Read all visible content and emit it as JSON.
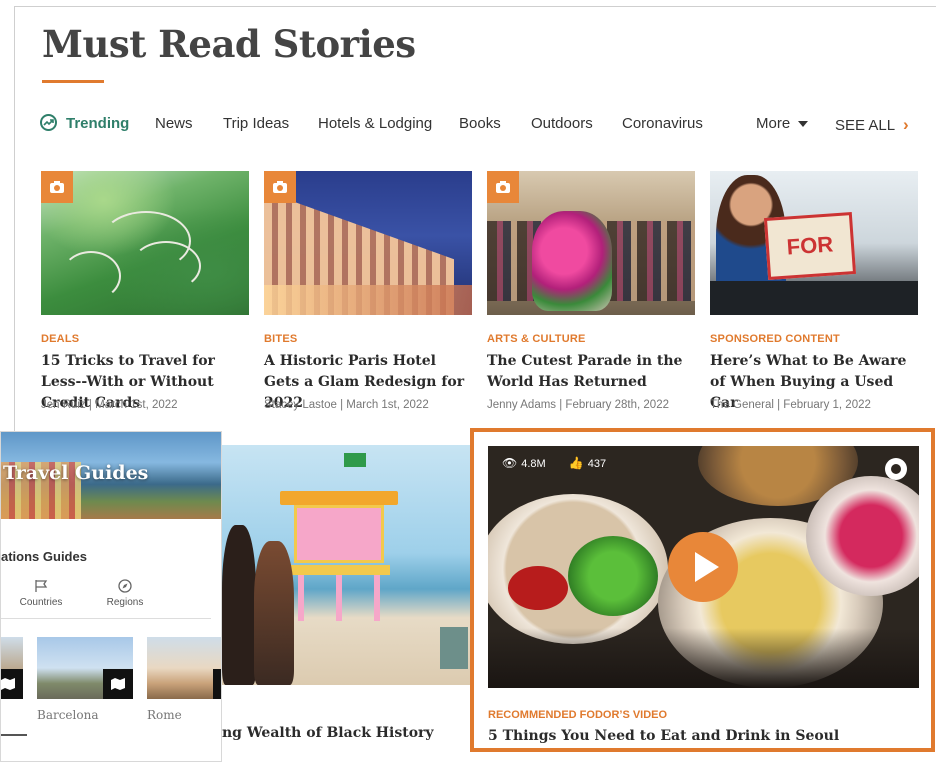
{
  "page": {
    "title": "Must Read Stories"
  },
  "nav": {
    "items": [
      {
        "label": "Trending",
        "active": true,
        "icon": "trending-icon"
      },
      {
        "label": "News"
      },
      {
        "label": "Trip Ideas"
      },
      {
        "label": "Hotels & Lodging"
      },
      {
        "label": "Books"
      },
      {
        "label": "Outdoors"
      },
      {
        "label": "Coronavirus"
      }
    ],
    "more_label": "More",
    "see_all_label": "SEE ALL"
  },
  "cards": [
    {
      "category": "DEALS",
      "headline": "15 Tricks to Travel for Less--With or Without Credit Cards",
      "byline": "Jen Ruiz | March 1st, 2022",
      "icon": "camera-icon"
    },
    {
      "category": "BITES",
      "headline": "A Historic Paris Hotel Gets a Glam Redesign for 2022",
      "byline": "Stacey Lastoe | March 1st, 2022",
      "icon": "camera-icon"
    },
    {
      "category": "ARTS & CULTURE",
      "headline": "The Cutest Parade in the World Has Returned",
      "byline": "Jenny Adams | February 28th, 2022",
      "icon": "camera-icon"
    },
    {
      "category": "SPONSORED CONTENT",
      "headline": "Here’s What to Be Aware of When Buying a Used Car",
      "byline": "The General | February 1, 2022",
      "sign_text": "FOR SALE"
    }
  ],
  "bottom_story": {
    "headline": "ng Wealth of Black History"
  },
  "video": {
    "views": "4.8M",
    "likes": "437",
    "category": "RECOMMENDED FODOR’S VIDEO",
    "title": "5 Things You Need to Eat and Drink in Seoul",
    "accent": "#e07a2e"
  },
  "guides": {
    "title": "Travel Guides",
    "subtitle": "ations Guides",
    "tabs": [
      {
        "label": "Countries",
        "icon": "flag-icon"
      },
      {
        "label": "Regions",
        "icon": "compass-icon"
      }
    ],
    "destinations": [
      {
        "label": "Barcelona"
      },
      {
        "label": "Rome"
      }
    ]
  },
  "colors": {
    "accent": "#e07a2e",
    "trending": "#2f7f6a"
  }
}
